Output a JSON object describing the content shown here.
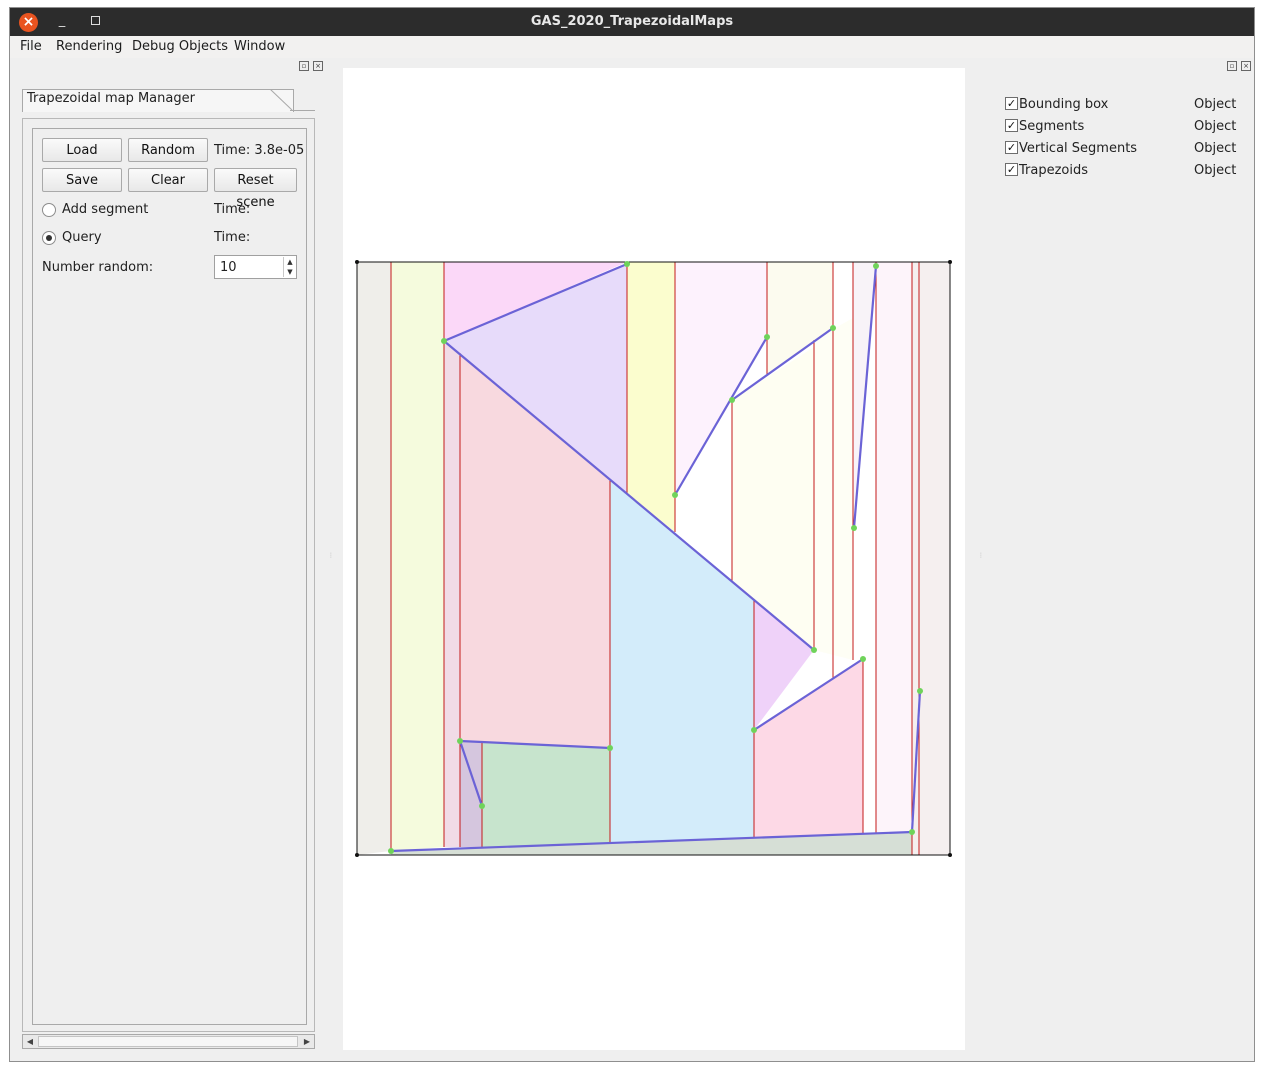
{
  "window": {
    "title": "GAS_2020_TrapezoidalMaps"
  },
  "menu": [
    "File",
    "Rendering",
    "Debug Objects",
    "Window"
  ],
  "panel": {
    "tab_label": "Trapezoidal map Manager",
    "buttons": {
      "load": "Load",
      "random": "Random",
      "save": "Save",
      "clear": "Clear",
      "reset": "Reset scene"
    },
    "time_main": "Time:  3.8e-05",
    "add_segment": {
      "label": "Add segment",
      "time": "Time:",
      "selected": false
    },
    "query": {
      "label": "Query",
      "time": "Time:",
      "selected": true
    },
    "number_random": {
      "label": "Number random:",
      "value": "10"
    }
  },
  "objects": [
    {
      "name": "Bounding box",
      "type": "Object",
      "checked": true
    },
    {
      "name": "Segments",
      "type": "Object",
      "checked": true
    },
    {
      "name": "Vertical Segments",
      "type": "Object",
      "checked": true
    },
    {
      "name": "Trapezoids",
      "type": "Object",
      "checked": true
    }
  ],
  "colors": {
    "segment": "#6b63d6",
    "vertical": "#c41a1a",
    "endpoint": "#6fd35a",
    "titlebar": "#2c2c2c",
    "close": "#e95420"
  }
}
